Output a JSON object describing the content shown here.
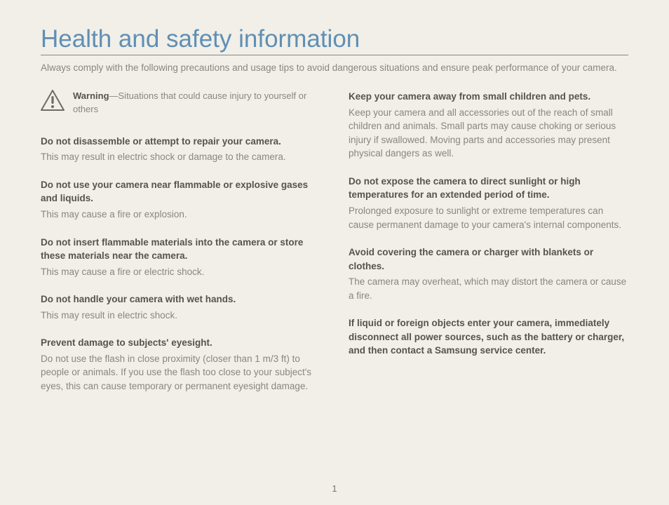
{
  "title": "Health and safety information",
  "intro": "Always comply with the following precautions and usage tips to avoid dangerous situations and ensure peak performance of your camera.",
  "warning": {
    "label": "Warning",
    "desc": "—Situations that could cause injury to yourself or others"
  },
  "left": [
    {
      "heading": "Do not disassemble or attempt to repair your camera.",
      "body": "This may result in electric shock or damage to the camera."
    },
    {
      "heading": "Do not use your camera near flammable or explosive gases and liquids.",
      "body": "This may cause a fire or explosion."
    },
    {
      "heading": "Do not insert flammable materials into the camera or store these materials near the camera.",
      "body": "This may cause a fire or electric shock."
    },
    {
      "heading": "Do not handle your camera with wet hands.",
      "body": "This may result in electric shock."
    },
    {
      "heading": "Prevent damage to subjects' eyesight.",
      "body": "Do not use the flash in close proximity (closer than 1 m/3 ft) to people or animals. If you use the flash too close to your subject's eyes, this can cause temporary or permanent eyesight damage."
    }
  ],
  "right": [
    {
      "heading": "Keep your camera away from small children and pets.",
      "body": "Keep your camera and all accessories out of the reach of small children and animals. Small parts may cause choking or serious injury if swallowed. Moving parts and accessories may present physical dangers as well."
    },
    {
      "heading": "Do not expose the camera to direct sunlight or high temperatures for an extended period of time.",
      "body": "Prolonged exposure to sunlight or extreme temperatures can cause permanent damage to your camera's internal components."
    },
    {
      "heading": "Avoid covering the camera or charger with blankets or clothes.",
      "body": "The camera may overheat, which may distort the camera or cause a fire."
    },
    {
      "heading": "If liquid or foreign objects enter your camera, immediately disconnect all power sources, such as the battery or charger, and then contact a Samsung service center.",
      "body": ""
    }
  ],
  "pageNumber": "1"
}
